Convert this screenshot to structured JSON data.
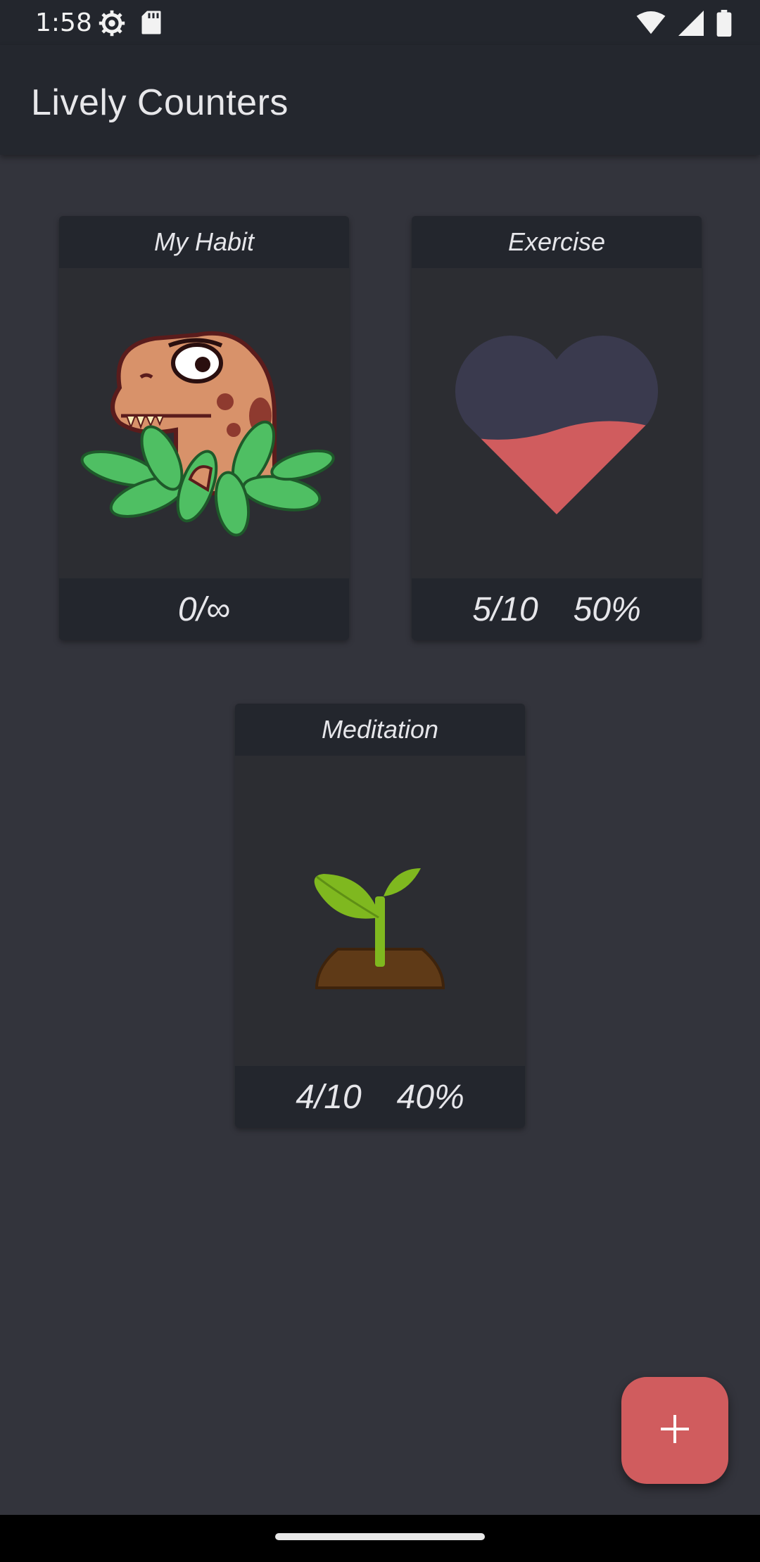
{
  "status_bar": {
    "time": "1:58",
    "icons_left": [
      "settings-gear-icon",
      "sd-card-icon"
    ],
    "icons_right": [
      "wifi-icon",
      "cell-signal-icon",
      "battery-icon"
    ]
  },
  "app_bar": {
    "title": "Lively Counters"
  },
  "counters": [
    {
      "title": "My Habit",
      "image": "dinosaur-in-leaves",
      "count": "0/∞",
      "percent": ""
    },
    {
      "title": "Exercise",
      "image": "heart-fill",
      "fill_level": 0.5,
      "count": "5/10",
      "percent": "50%"
    },
    {
      "title": "Meditation",
      "image": "sprout-in-soil",
      "count": "4/10",
      "percent": "40%"
    }
  ],
  "fab": {
    "icon": "plus-icon",
    "label": "+"
  },
  "colors": {
    "background": "#33343c",
    "bar": "#24272e",
    "card": "#2c2d32",
    "accent": "#d05c5e"
  }
}
